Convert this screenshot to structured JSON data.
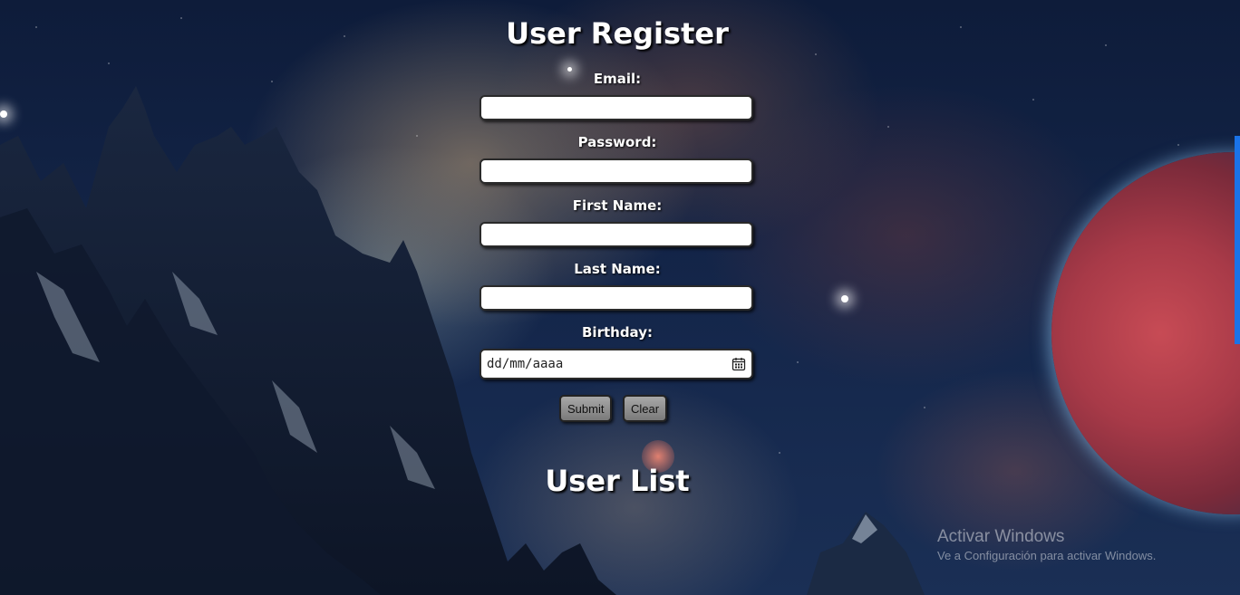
{
  "register": {
    "title": "User Register",
    "fields": [
      {
        "label": "Email:",
        "value": ""
      },
      {
        "label": "Password:",
        "value": ""
      },
      {
        "label": "First Name:",
        "value": ""
      },
      {
        "label": "Last Name:",
        "value": ""
      },
      {
        "label": "Birthday:",
        "placeholder": "dd/mm/aaaa"
      }
    ],
    "submit_label": "Submit",
    "clear_label": "Clear"
  },
  "list": {
    "title": "User List"
  },
  "watermark": {
    "title": "Activar Windows",
    "subtitle": "Ve a Configuración para activar Windows."
  },
  "icons": {
    "birthday_picker": "calendar-icon"
  },
  "colors": {
    "heading_text": "#ffffff",
    "input_bg": "#ffffff",
    "button_bg": "#8f8f8f",
    "planet": "#c74b55"
  }
}
